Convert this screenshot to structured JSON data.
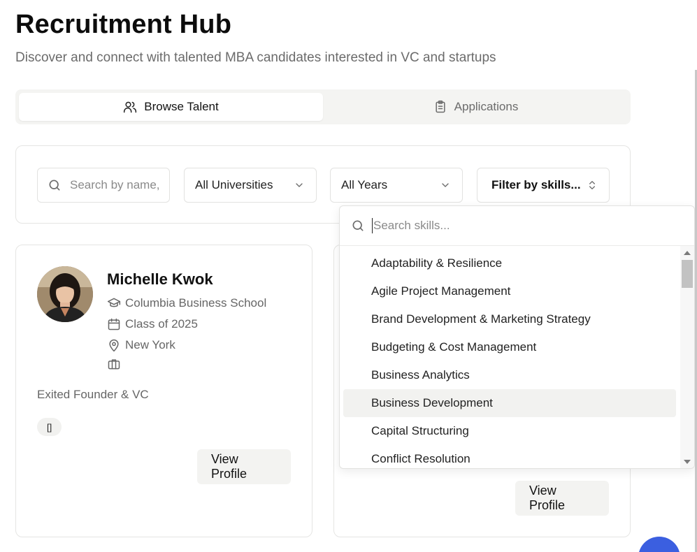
{
  "header": {
    "title": "Recruitment Hub",
    "subtitle": "Discover and connect with talented MBA candidates interested in VC and startups"
  },
  "tabs": [
    {
      "label": "Browse Talent",
      "icon": "users-icon",
      "active": true
    },
    {
      "label": "Applications",
      "icon": "clipboard-icon",
      "active": false
    }
  ],
  "filters": {
    "search_placeholder": "Search by name,",
    "university": "All Universities",
    "year": "All Years",
    "skills": "Filter by skills..."
  },
  "candidates": [
    {
      "name": "Michelle Kwok",
      "school": "Columbia Business School",
      "class": "Class of 2025",
      "location": "New York",
      "headline": "Exited Founder & VC",
      "badge": "[]",
      "button": "View Profile"
    },
    {
      "button": "View Profile"
    }
  ],
  "skills_dropdown": {
    "search_placeholder": "Search skills...",
    "items": [
      "Adaptability & Resilience",
      "Agile Project Management",
      "Brand Development & Marketing Strategy",
      "Budgeting & Cost Management",
      "Business Analytics",
      "Business Development",
      "Capital Structuring",
      "Conflict Resolution"
    ],
    "highlighted_index": 5
  },
  "colors": {
    "accent_fab": "#3b5fe0",
    "tab_bg": "#f4f4f2"
  }
}
